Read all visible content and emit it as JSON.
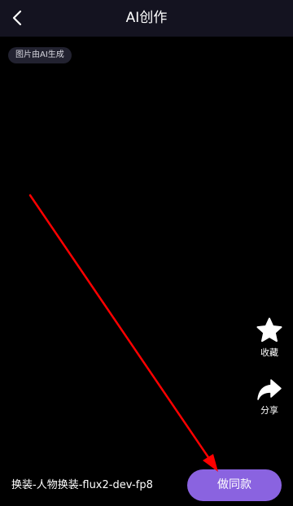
{
  "header": {
    "title": "AI创作",
    "back_icon": "chevron-left-icon"
  },
  "badge": {
    "label": "图片由AI生成"
  },
  "actions": {
    "favorite": {
      "label": "收藏",
      "icon": "star-icon"
    },
    "share": {
      "label": "分享",
      "icon": "share-arrow-icon"
    }
  },
  "footer": {
    "title": "换装-人物换装-flux2-dev-fp8",
    "make_same_label": "做同款"
  },
  "colors": {
    "background": "#000000",
    "topbar": "#141320",
    "accent": "#8a63e0",
    "annotation_arrow": "#ff0000"
  }
}
